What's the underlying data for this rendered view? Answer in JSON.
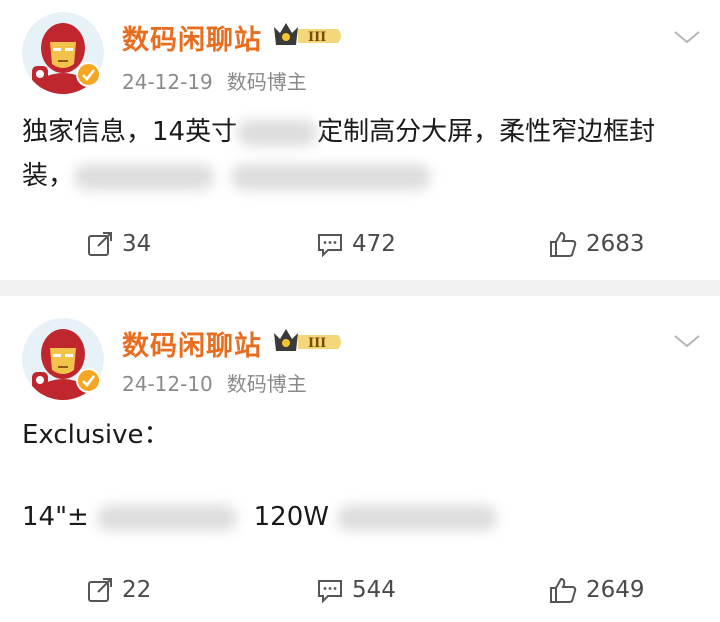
{
  "posts": [
    {
      "username": "数码闲聊站",
      "level_badge": "III",
      "date": "24-12-19",
      "role": "数码博主",
      "content": {
        "line1_a": "独家信息，14英寸",
        "line1_b": "定制高分大屏，柔性窄边框封",
        "line2_a": "装，"
      },
      "actions": {
        "reposts": "34",
        "comments": "472",
        "likes": "2683"
      }
    },
    {
      "username": "数码闲聊站",
      "level_badge": "III",
      "date": "24-12-10",
      "role": "数码博主",
      "content": {
        "line1": "Exclusive：",
        "line2_a": "14\"±",
        "line2_b": "120W"
      },
      "actions": {
        "reposts": "22",
        "comments": "544",
        "likes": "2649"
      }
    }
  ],
  "icons": {
    "share": "share-icon",
    "comment": "comment-icon",
    "like": "thumbs-up-icon",
    "more": "chevron-down-icon",
    "verified": "verified-badge-icon",
    "crown": "crown-icon"
  },
  "colors": {
    "username": "#e86d1f",
    "meta": "#8a8a8a",
    "verified": "#f5a623",
    "separator": "#f2f2f2"
  }
}
